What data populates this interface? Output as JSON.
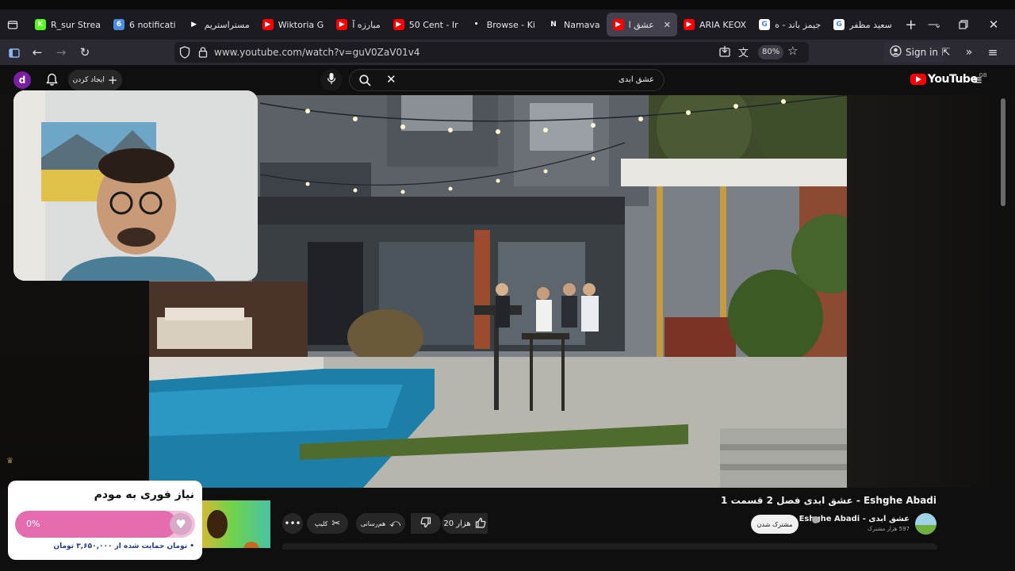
{
  "browser": {
    "tabs": [
      {
        "title": "R_sur Strea",
        "favicon_color": "#53fc18",
        "favicon_glyph": "K"
      },
      {
        "title": "6 notificati",
        "favicon_color": "#4a90e2",
        "favicon_glyph": "6"
      },
      {
        "title": "مستراستریم",
        "favicon_color": "#1c1b22",
        "favicon_glyph": "▶"
      },
      {
        "title": "Wiktoria G",
        "favicon_color": "#ff0000",
        "favicon_glyph": "▶"
      },
      {
        "title": "مبارزه آ",
        "favicon_color": "#ff0000",
        "favicon_glyph": "▶"
      },
      {
        "title": "50 Cent - Ir",
        "favicon_color": "#ff0000",
        "favicon_glyph": "▶"
      },
      {
        "title": "Browse - Ki",
        "favicon_color": "#1c1b22",
        "favicon_glyph": "•"
      },
      {
        "title": "Namava",
        "favicon_color": "#1c1b22",
        "favicon_glyph": "N"
      },
      {
        "title": "عشق ا",
        "favicon_color": "#ff0000",
        "favicon_glyph": "▶",
        "active": true
      },
      {
        "title": "ARIA KEOX",
        "favicon_color": "#ff0000",
        "favicon_glyph": "▶"
      },
      {
        "title": "جیمز باند - ه",
        "favicon_color": "#ffffff",
        "favicon_glyph": "G"
      },
      {
        "title": "سعید مظفر",
        "favicon_color": "#ffffff",
        "favicon_glyph": "G"
      }
    ],
    "url": "www.youtube.com/watch?v=guV0ZaV01v4",
    "zoom": "80%",
    "sign_in": "Sign in"
  },
  "youtube": {
    "logo_text": "YouTube",
    "logo_region": "GB",
    "search_value": "عشق ابدی",
    "create_label": "ایجاد کردن",
    "avatar_letter": "d",
    "video_title": "Eshghe Abadi - عشق ابدی فصل 2 قسمت 1",
    "channel_name": "Eshghe Abadi - عشق ابدی",
    "subscribers": "597 هزار مشترک",
    "subscribe_label": "مشترک شدن",
    "like_count": "20 هزار",
    "share_label": "هم‌رسانی",
    "clip_label": "کلیپ"
  },
  "donation": {
    "title": "نیاز فوری به مودم",
    "percent": "0%",
    "progress_fraction": 0.9,
    "supported_text": "• تومان حمایت شده از ۳,۶۵۰,۰۰۰ تومان"
  }
}
